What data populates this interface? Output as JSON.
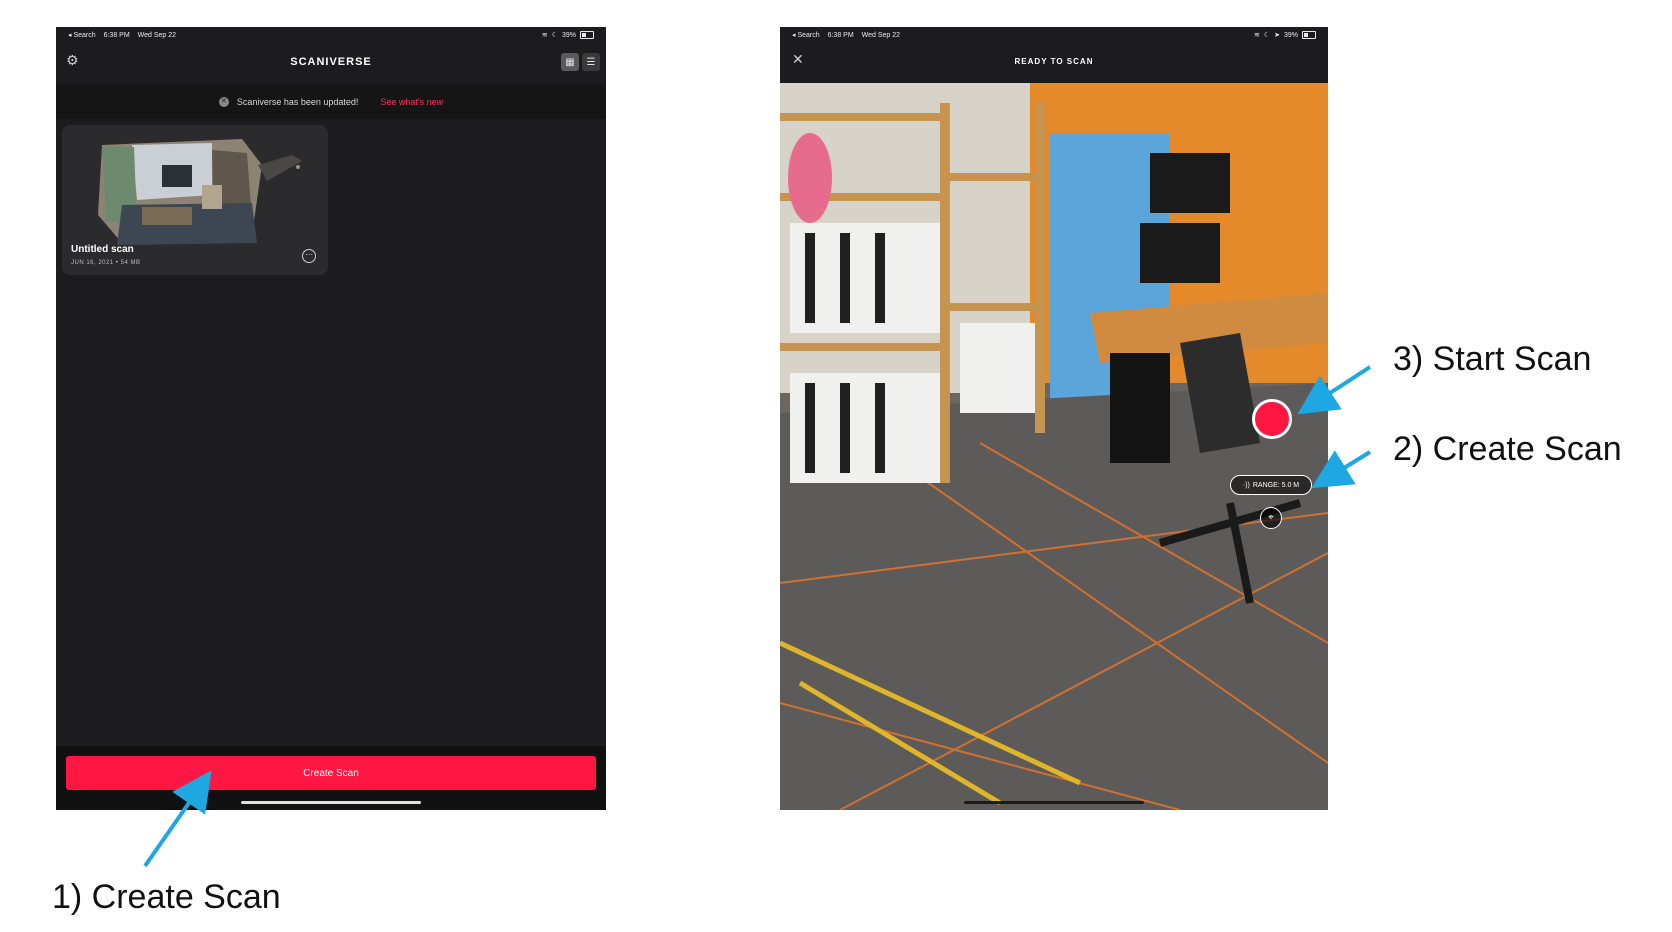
{
  "left_screen": {
    "status": {
      "back": "◂ Search",
      "time": "6:38 PM",
      "date": "Wed Sep 22",
      "battery": "39%"
    },
    "title": "SCANIVERSE",
    "banner": {
      "text": "Scaniverse has been updated!",
      "link": "See what's new"
    },
    "scan_card": {
      "title": "Untitled scan",
      "meta": "JUN 16, 2021 • 54 MB"
    },
    "create_button": "Create Scan"
  },
  "right_screen": {
    "status": {
      "back": "◂ Search",
      "time": "6:38 PM",
      "date": "Wed Sep 22",
      "battery": "39%"
    },
    "title": "READY TO SCAN",
    "range_label": "RANGE: 5.0 M"
  },
  "annotations": {
    "step1": "1) Create Scan",
    "step2": "2) Create Scan",
    "step3": "3) Start Scan"
  },
  "colors": {
    "accent_red": "#ff1744",
    "annotation_arrow": "#1ea7e1",
    "app_background": "#1c1c1e"
  },
  "icons": {
    "settings": "gear-icon",
    "grid_view": "grid-icon",
    "list_view": "list-icon",
    "dismiss": "close-icon",
    "more": "more-icon",
    "range": "wave-icon",
    "location": "location-pin-icon"
  }
}
